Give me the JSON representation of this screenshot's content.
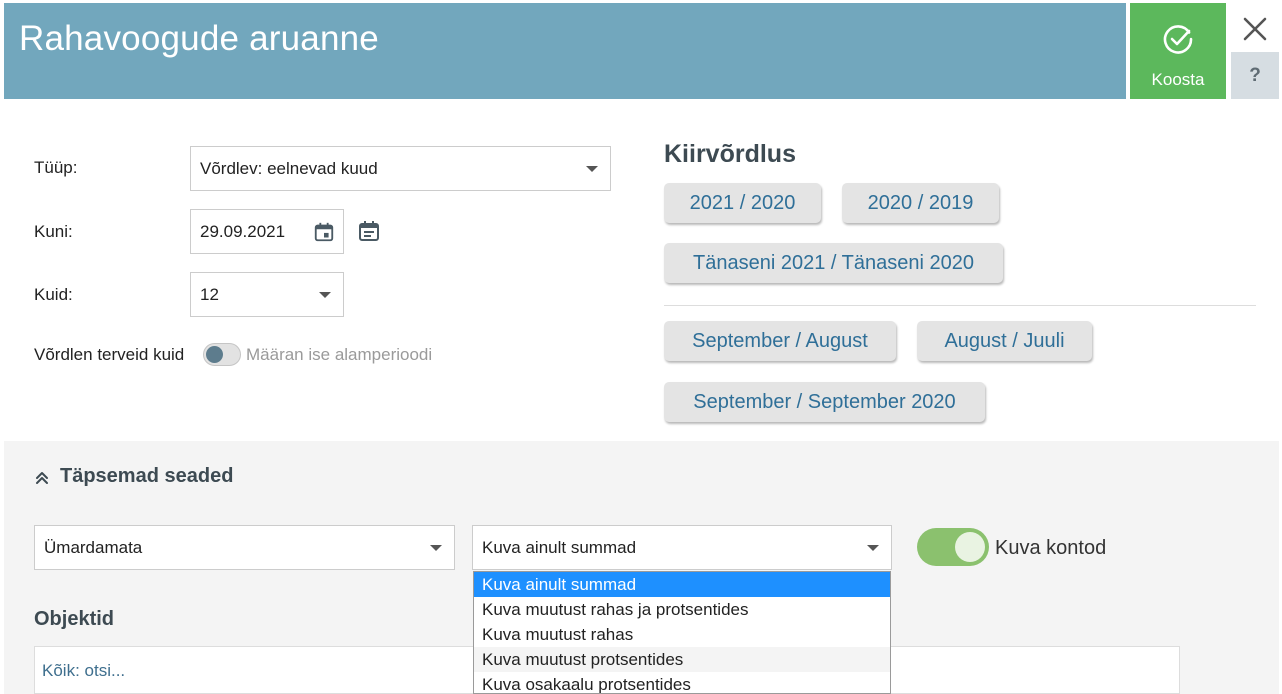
{
  "header": {
    "title": "Rahavoogude aruanne"
  },
  "actions": {
    "koosta_label": "Koosta",
    "close_symbol": "✕",
    "help_symbol": "?"
  },
  "form": {
    "type_label": "Tüüp:",
    "type_value": "Võrdlev: eelnevad kuud",
    "until_label": "Kuni:",
    "until_value": "29.09.2021",
    "months_label": "Kuid:",
    "months_value": "12",
    "compare_full_label": "Võrdlen terveid kuid",
    "custom_period_label": "Määran ise alamperioodi"
  },
  "quick": {
    "title": "Kiirvõrdlus",
    "buttons": [
      "2021 / 2020",
      "2020 / 2019",
      "Tänaseni 2021 / Tänaseni 2020",
      "September / August",
      "August / Juuli",
      "September / September 2020"
    ]
  },
  "advanced": {
    "title": "Täpsemad seaded",
    "rounding_value": "Ümardamata",
    "display_value": "Kuva ainult summad",
    "show_accounts_label": "Kuva kontod",
    "objects_label": "Objektid",
    "objects_placeholder": "Kõik: otsi...",
    "dropdown_options": [
      "Kuva ainult summad",
      "Kuva muutust rahas ja protsentides",
      "Kuva muutust rahas",
      "Kuva muutust protsentides",
      "Kuva osakaalu protsentides"
    ]
  },
  "colors": {
    "header": "#72a7bd",
    "primary_action": "#5cb85c",
    "toggle_on": "#8bc16e",
    "selected_option": "#1e90ff",
    "link": "#2f6f98"
  }
}
